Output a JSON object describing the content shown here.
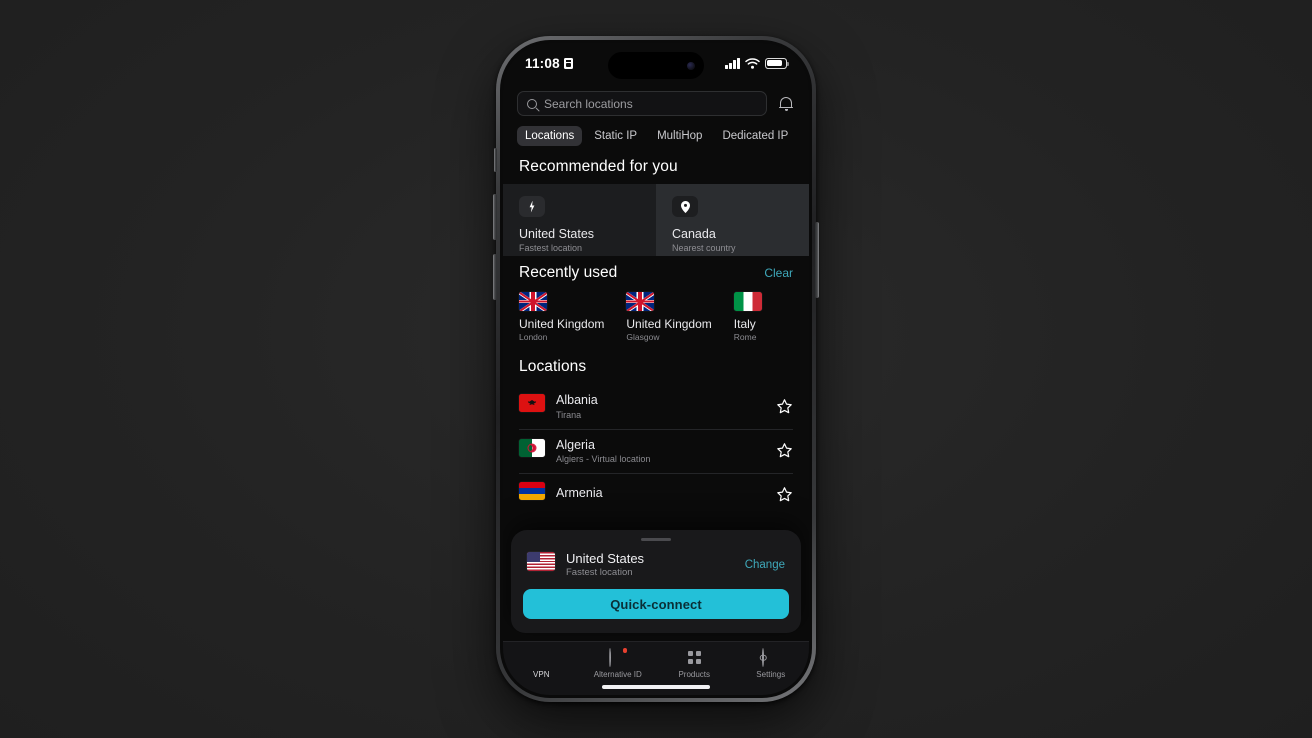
{
  "status_bar": {
    "time": "11:08",
    "badge_icon": "vpn-badge-icon",
    "signal_icon": "cellular-signal-icon",
    "wifi_icon": "wifi-icon",
    "battery_icon": "battery-icon"
  },
  "search": {
    "placeholder": "Search locations",
    "icon": "search-icon",
    "notification_icon": "bell-icon"
  },
  "tabs": [
    {
      "label": "Locations",
      "active": true
    },
    {
      "label": "Static IP",
      "active": false
    },
    {
      "label": "MultiHop",
      "active": false
    },
    {
      "label": "Dedicated IP",
      "active": false
    }
  ],
  "recommended": {
    "title": "Recommended for you",
    "cards": [
      {
        "name": "United States",
        "subtitle": "Fastest location",
        "icon": "lightning-bolt-icon"
      },
      {
        "name": "Canada",
        "subtitle": "Nearest country",
        "icon": "map-pin-icon"
      }
    ]
  },
  "recently_used": {
    "title": "Recently used",
    "clear_label": "Clear",
    "items": [
      {
        "name": "United Kingdom",
        "city": "London",
        "flag": "flag-uk"
      },
      {
        "name": "United Kingdom",
        "city": "Glasgow",
        "flag": "flag-uk"
      },
      {
        "name": "Italy",
        "city": "Rome",
        "flag": "flag-italy"
      }
    ]
  },
  "locations": {
    "title": "Locations",
    "rows": [
      {
        "name": "Albania",
        "city": "Tirana",
        "flag": "flag-albania",
        "favorite_icon": "star-outline-icon"
      },
      {
        "name": "Algeria",
        "city": "Algiers - Virtual location",
        "flag": "flag-algeria",
        "favorite_icon": "star-outline-icon"
      },
      {
        "name": "Armenia",
        "city": "",
        "flag": "flag-armenia",
        "favorite_icon": "star-outline-icon"
      }
    ]
  },
  "bottom_sheet": {
    "name": "United States",
    "subtitle": "Fastest location",
    "change_label": "Change",
    "connect_label": "Quick-connect",
    "flag": "flag-usa",
    "grabber": "sheet-grabber"
  },
  "tab_bar": [
    {
      "label": "VPN",
      "icon": "shield-icon",
      "active": true,
      "badge": false
    },
    {
      "label": "Alternative ID",
      "icon": "person-id-icon",
      "active": false,
      "badge": true
    },
    {
      "label": "Products",
      "icon": "grid-icon",
      "active": false,
      "badge": false
    },
    {
      "label": "Settings",
      "icon": "gear-icon",
      "active": false,
      "badge": false
    }
  ],
  "colors": {
    "accent_cyan": "#23c0d8",
    "link_teal": "#3fa9bb",
    "badge_red": "#e8402f",
    "screen_bg": "#0b0b0b",
    "backdrop": "#242424"
  }
}
